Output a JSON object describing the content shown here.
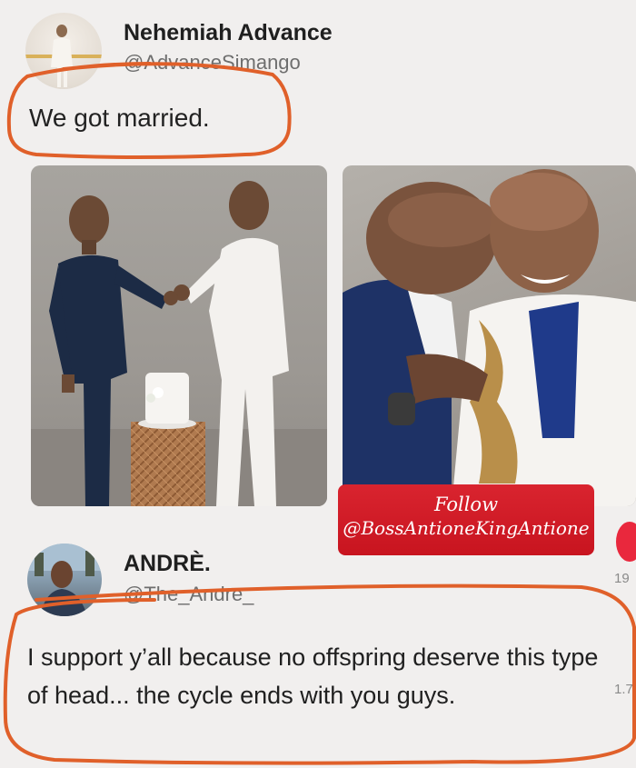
{
  "post": {
    "author_name": "Nehemiah Advance",
    "author_handle": "@AdvanceSimango",
    "text": "We got married."
  },
  "overlay": {
    "follow_line1": "Follow",
    "follow_line2": "@BossAntioneKingAntione"
  },
  "reply": {
    "author_name": "ANDRÈ.",
    "author_handle": "@The_Andre_",
    "text": "I support y’all because no offspring deserve this type of head... the cycle ends with you guys.",
    "side_count_top": "19",
    "side_count_bottom": "1.7"
  },
  "colors": {
    "background": "#f1efee",
    "annotation_circle": "#e0602a",
    "follow_box": "#d21c27"
  },
  "icons": {
    "heart": "heart-icon"
  }
}
